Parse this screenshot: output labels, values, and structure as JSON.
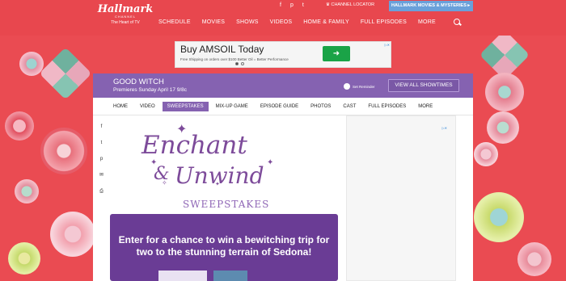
{
  "header": {
    "logo": {
      "brand": "Hallmark",
      "channel": "CHANNEL",
      "tagline": "The Heart of TV"
    },
    "nav": [
      "SCHEDULE",
      "MOVIES",
      "SHOWS",
      "VIDEOS",
      "HOME & FAMILY",
      "FULL EPISODES",
      "MORE"
    ],
    "social_icons": [
      "f",
      "p",
      "t"
    ],
    "channel_locator": "CHANNEL LOCATOR",
    "movies_mysteries": "HALLMARK MOVIES & MYSTERIES ▸"
  },
  "banner_ad": {
    "headline": "Buy AMSOIL Today",
    "subtext": "Free Shipping on orders over $100 Better Oil = Better Performance",
    "cta": "➜",
    "adchoices": "▷✕"
  },
  "show": {
    "title": "GOOD WITCH",
    "premiere": "Premieres Sunday April 17 9/8c",
    "reminder": "Set Reminder",
    "showtimes": "VIEW ALL SHOWTIMES"
  },
  "subnav": {
    "tabs": [
      "HOME",
      "VIDEO",
      "SWEEPSTAKES",
      "MIX-UP GAME",
      "EPISODE GUIDE",
      "PHOTOS",
      "CAST",
      "FULL EPISODES",
      "MORE"
    ],
    "active": "SWEEPSTAKES"
  },
  "share": [
    "f",
    "t",
    "p",
    "✉",
    "⎙"
  ],
  "sweepstakes": {
    "line1": "Enchant",
    "amp": "&",
    "line2": "Unwind",
    "line3": "SWEEPSTAKES",
    "promo": "Enter for a chance to win a bewitching trip for two to the stunning terrain of Sedona!"
  },
  "side_ad": {
    "adchoices": "▷✕"
  },
  "colors": {
    "topbar": "#e8474e",
    "purple": "#8562b1",
    "promo": "#6a3c95",
    "ad_green": "#1aa347"
  }
}
